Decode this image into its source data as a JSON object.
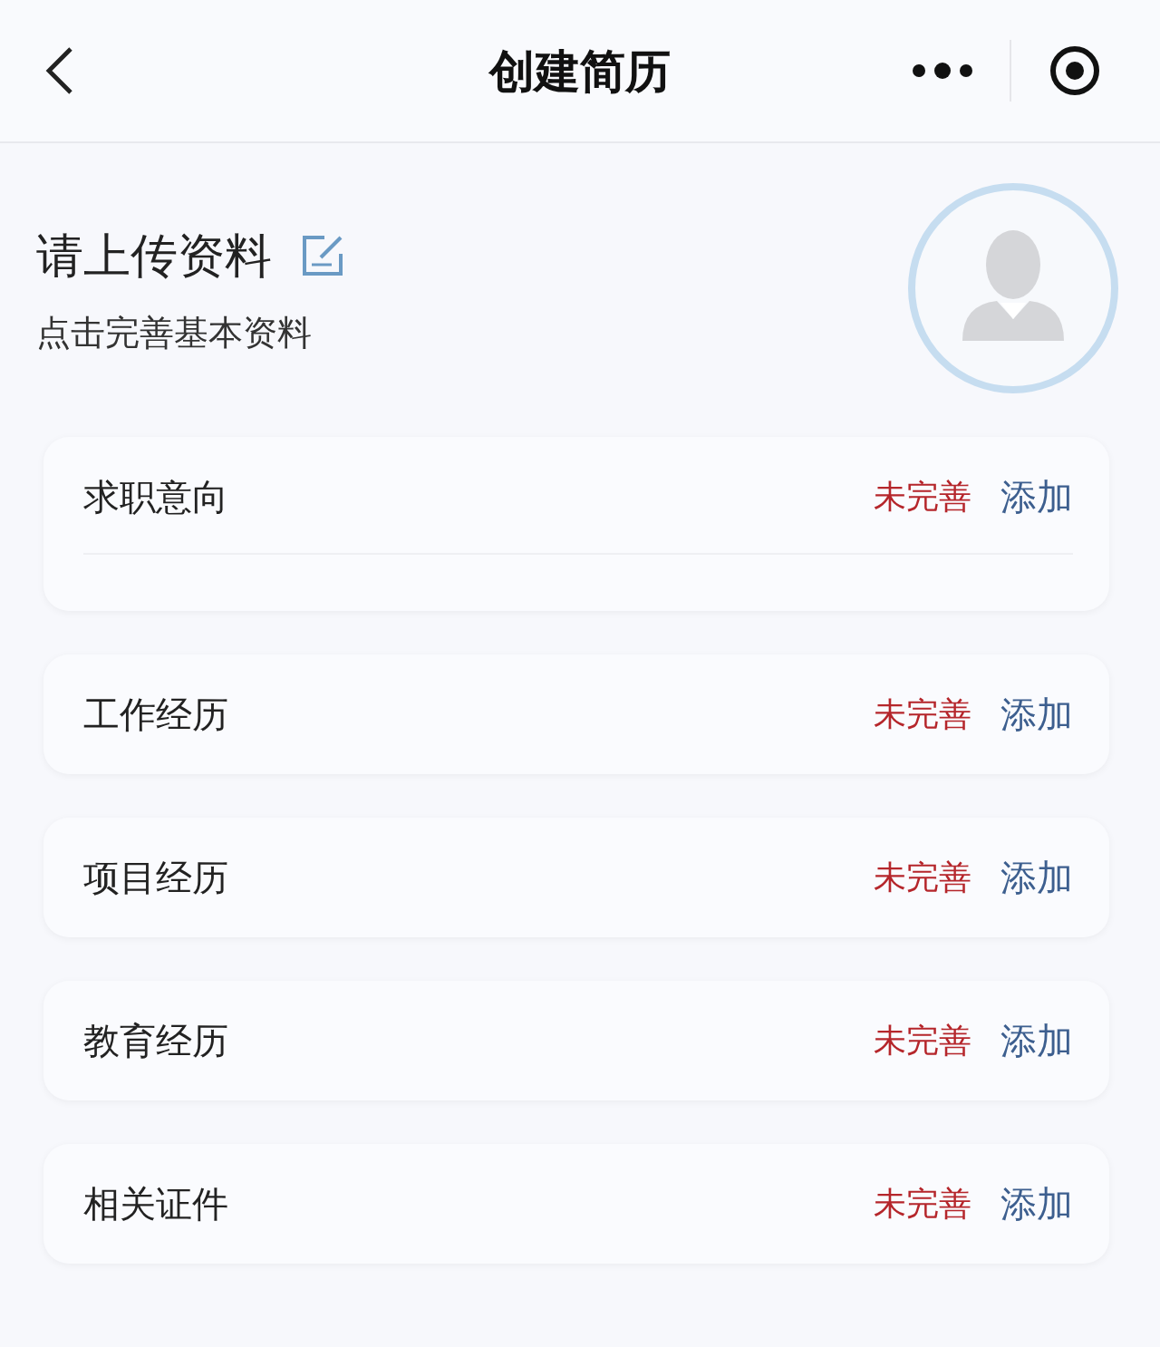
{
  "nav_bar": {
    "title": "创建简历"
  },
  "profile": {
    "title": "请上传资料",
    "subtitle": "点击完善基本资料"
  },
  "sections": [
    {
      "label": "求职意向",
      "status": "未完善",
      "action": "添加",
      "kind": "expanded"
    },
    {
      "label": "工作经历",
      "status": "未完善",
      "action": "添加",
      "kind": "plain"
    },
    {
      "label": "项目经历",
      "status": "未完善",
      "action": "添加",
      "kind": "plain"
    },
    {
      "label": "教育经历",
      "status": "未完善",
      "action": "添加",
      "kind": "plain"
    },
    {
      "label": "相关证件",
      "status": "未完善",
      "action": "添加",
      "kind": "plain"
    }
  ]
}
